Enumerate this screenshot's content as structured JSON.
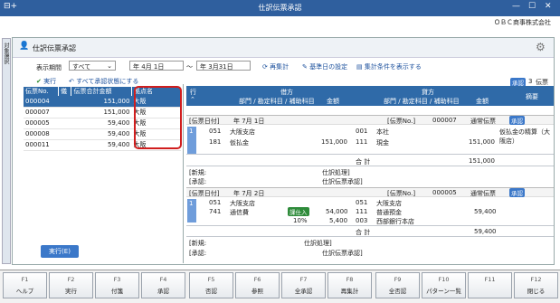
{
  "window": {
    "title": "仕訳伝票承認",
    "company": "ＯＢＣ商事株式会社"
  },
  "sidebar": {
    "label": "対象選択"
  },
  "panel": {
    "title": "仕訳伝票承認"
  },
  "filter": {
    "period_label": "表示期間",
    "period_value": "すべて",
    "from_era": "年",
    "from_date": "4月 1日",
    "range_sep": "〜",
    "to_era": "年",
    "to_date": "3月31日",
    "refresh": "再集計",
    "base_date": "基準日の設定",
    "show_conditions": "集計条件を表示する",
    "execute": "実行",
    "to_unapproved": "すべて承認状態にする"
  },
  "left_table": {
    "headers": [
      "伝票No.",
      "儀",
      "伝票合計金額",
      "拠点名"
    ],
    "rows": [
      {
        "no": "000004",
        "amount": "151,000",
        "site": "大阪"
      },
      {
        "no": "000007",
        "amount": "151,000",
        "site": "大阪"
      },
      {
        "no": "000005",
        "amount": "59,400",
        "site": "大阪"
      },
      {
        "no": "000008",
        "amount": "59,400",
        "site": "大阪"
      },
      {
        "no": "000011",
        "amount": "59,400",
        "site": "大阪"
      }
    ]
  },
  "exec_button": "実行(E)",
  "right": {
    "approve_badge": "承認",
    "count": "3",
    "count_unit": "伝票",
    "header_row": "行",
    "debit": "借方",
    "credit": "貸方",
    "summary": "摘要",
    "dept_cols": "部門 / 勘定科目 / 補助科目",
    "amount": "金額",
    "vouchers": [
      {
        "date_label": "[伝票日付]",
        "date": "年 7月 1日",
        "no_label": "[伝票No.]",
        "no": "000007",
        "type": "通常伝票",
        "badge": "承認",
        "lines": [
          {
            "row": "1",
            "dcode1": "051",
            "dname1": "大阪支店",
            "ccode1": "001",
            "cname1": "本社",
            "dcode2": "181",
            "dname2": "仮払金",
            "damount": "151,000",
            "ccode2": "111",
            "cname2": "現金",
            "camount": "151,000",
            "memo": "仮払金の精算（大阪店）"
          }
        ],
        "total_label": "合 計",
        "total": "151,000",
        "new_label": "[新規:",
        "new_action": "仕訳処理]",
        "approve_label": "[承認:",
        "approve_action": "仕訳伝票承認]"
      },
      {
        "date_label": "[伝票日付]",
        "date": "年 7月 2日",
        "no_label": "[伝票No.]",
        "no": "000005",
        "type": "通常伝票",
        "badge": "承認",
        "lines": [
          {
            "row": "1",
            "dcode1": "051",
            "dname1": "大阪支店",
            "ccode1": "051",
            "cname1": "大阪支店",
            "dcode2": "741",
            "dname2": "通信費",
            "tax": "課仕入",
            "damount": "54,000",
            "ccode2": "111",
            "cname2": "普通預金",
            "camount": "59,400",
            "rate": "10%",
            "taxamount": "5,400",
            "ccode3": "003",
            "cname3": "西部銀行本店"
          }
        ],
        "total_label": "合 計",
        "total": "59,400",
        "new_label": "[新規:",
        "new_action": "仕訳処理]",
        "approve_label": "[承認:",
        "approve_action": "仕訳伝票承認]"
      }
    ]
  },
  "fkeys": [
    {
      "n": "F1",
      "l": "ヘルプ"
    },
    {
      "n": "F2",
      "l": "実行"
    },
    {
      "n": "F3",
      "l": "付箋"
    },
    {
      "n": "F4",
      "l": "承認"
    },
    {
      "n": "F5",
      "l": "否認"
    },
    {
      "n": "F6",
      "l": "参照"
    },
    {
      "n": "F7",
      "l": "全承認"
    },
    {
      "n": "F8",
      "l": "再集計"
    },
    {
      "n": "F9",
      "l": "全否認"
    },
    {
      "n": "F10",
      "l": "パターン一覧"
    },
    {
      "n": "F11",
      "l": ""
    },
    {
      "n": "F12",
      "l": "閉じる"
    }
  ]
}
